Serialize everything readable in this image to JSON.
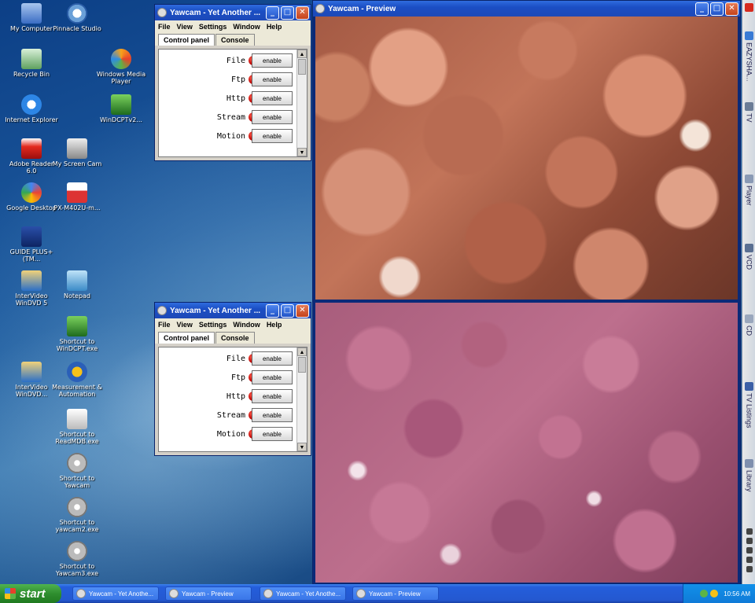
{
  "desktop_icons": [
    {
      "label": "My Computer"
    },
    {
      "label": "Pinnacle Studio"
    },
    {
      "label": "Recycle Bin"
    },
    {
      "label": "Windows Media Player"
    },
    {
      "label": "Internet Explorer"
    },
    {
      "label": "WinDCPTv2..."
    },
    {
      "label": "Adobe Reader 6.0"
    },
    {
      "label": "My Screen Cam"
    },
    {
      "label": "Google Desktop"
    },
    {
      "label": "PX-M402U-m..."
    },
    {
      "label": "GUIDE PLUS+(TM..."
    },
    {
      "label": "InterVideo WinDVD 5"
    },
    {
      "label": "Notepad"
    },
    {
      "label": "Shortcut to WinDCPT.exe"
    },
    {
      "label": "InterVideo WinDVD..."
    },
    {
      "label": "Measurement & Automation"
    },
    {
      "label": "Shortcut to ReadMDB.exe"
    },
    {
      "label": "Shortcut to Yawcam"
    },
    {
      "label": "Shortcut to yawcam2.exe"
    },
    {
      "label": "Shortcut to Yawcam3.exe"
    }
  ],
  "yawcam_window": {
    "title": "Yawcam - Yet Another ...",
    "menu": [
      "File",
      "View",
      "Settings",
      "Window",
      "Help"
    ],
    "tabs": [
      "Control panel",
      "Console"
    ],
    "rows": [
      {
        "name": "File",
        "button": "enable"
      },
      {
        "name": "Ftp",
        "button": "enable"
      },
      {
        "name": "Http",
        "button": "enable"
      },
      {
        "name": "Stream",
        "button": "enable"
      },
      {
        "name": "Motion",
        "button": "enable"
      }
    ]
  },
  "preview_window": {
    "title": "Yawcam - Preview"
  },
  "sidebar": {
    "items": [
      "EAZYSHA...",
      "TV",
      "Player",
      "VCD",
      "CD",
      "TV Listings",
      "Library"
    ]
  },
  "taskbar": {
    "start_label": "start",
    "tasks": [
      "Yawcam - Yet Anothe...",
      "Yawcam - Preview",
      "Yawcam - Yet Anothe...",
      "Yawcam - Preview"
    ],
    "clock": "10:56 AM"
  }
}
